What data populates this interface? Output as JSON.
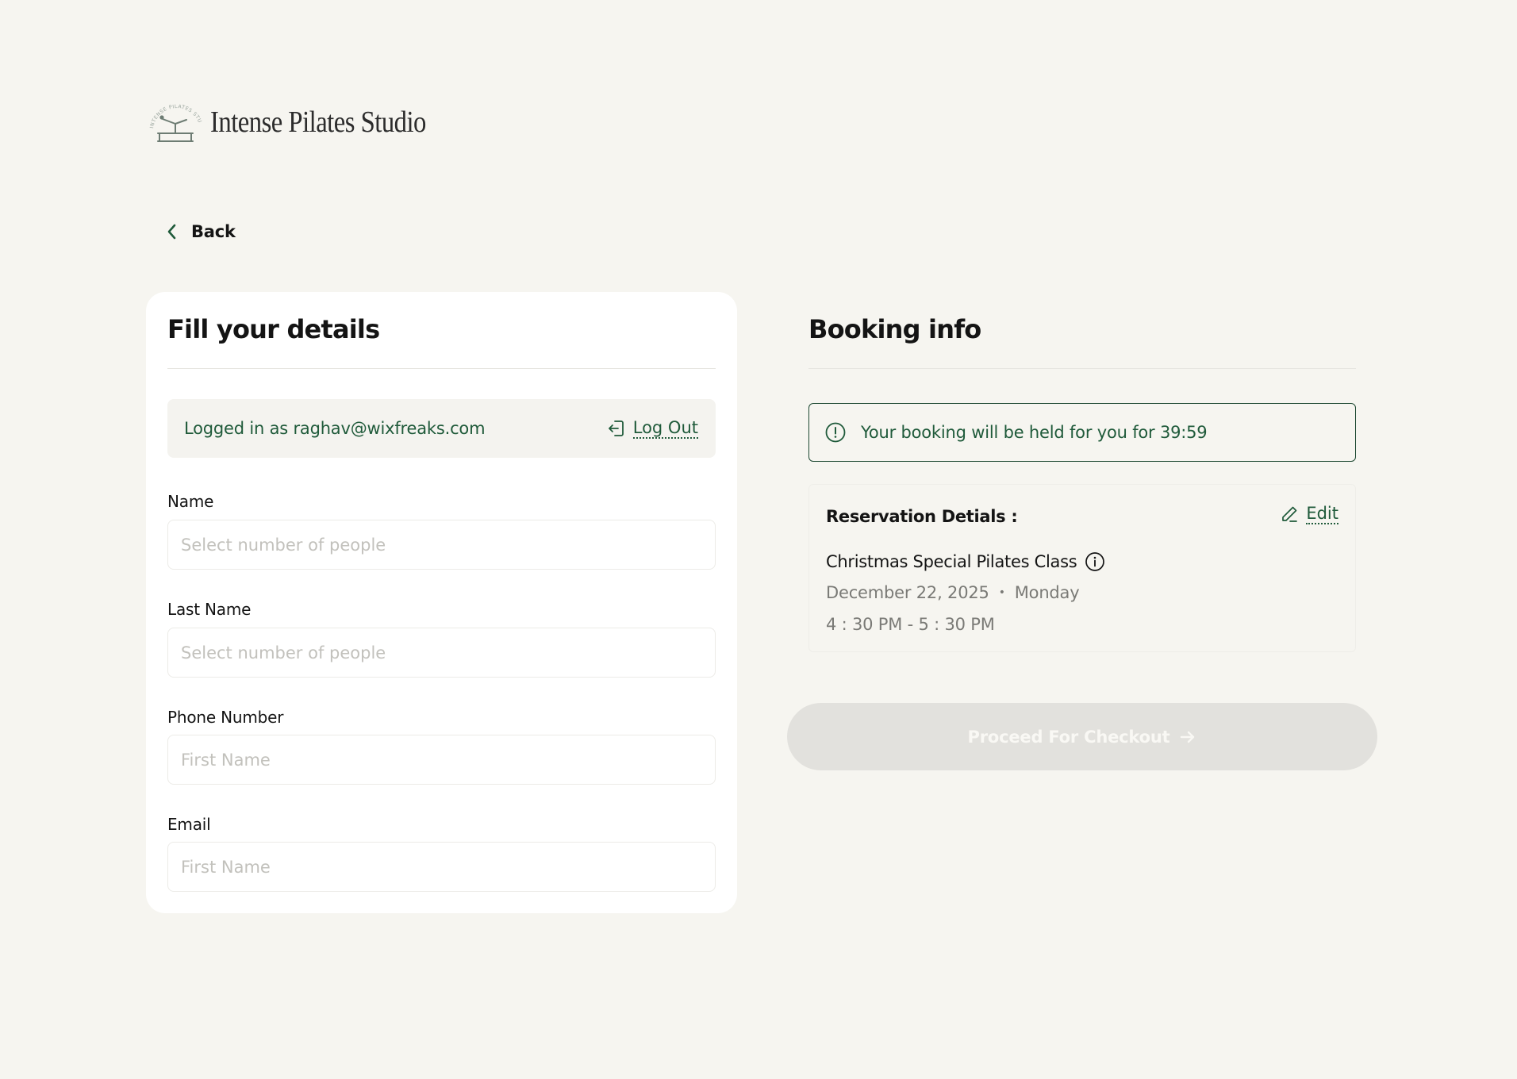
{
  "brand": {
    "name": "Intense Pilates Studio",
    "badge_text": "INTENSE PILATES STUDIO"
  },
  "nav": {
    "back_label": "Back"
  },
  "details": {
    "title": "Fill your details",
    "logged_in_text": "Logged in as raghav@wixfreaks.com",
    "logout_label": "Log Out",
    "fields": [
      {
        "label": "Name",
        "placeholder": "Select number of people"
      },
      {
        "label": "Last Name",
        "placeholder": "Select number of people"
      },
      {
        "label": "Phone Number",
        "placeholder": "First Name"
      },
      {
        "label": "Email",
        "placeholder": "First Name"
      }
    ]
  },
  "booking": {
    "title": "Booking info",
    "hold_message": "Your booking will be held for you for 39:59",
    "reservation": {
      "title": "Reservation Detials :",
      "edit_label": "Edit",
      "class_name": "Christmas Special Pilates Class",
      "date": "December 22, 2025",
      "day": "Monday",
      "time": "4 : 30 PM -  5 : 30 PM"
    },
    "checkout_label": "Proceed For Checkout"
  },
  "colors": {
    "background": "#f6f5f0",
    "accent_green": "#1f5a3a",
    "card": "#ffffff",
    "disabled_button": "#e2e1dd"
  }
}
